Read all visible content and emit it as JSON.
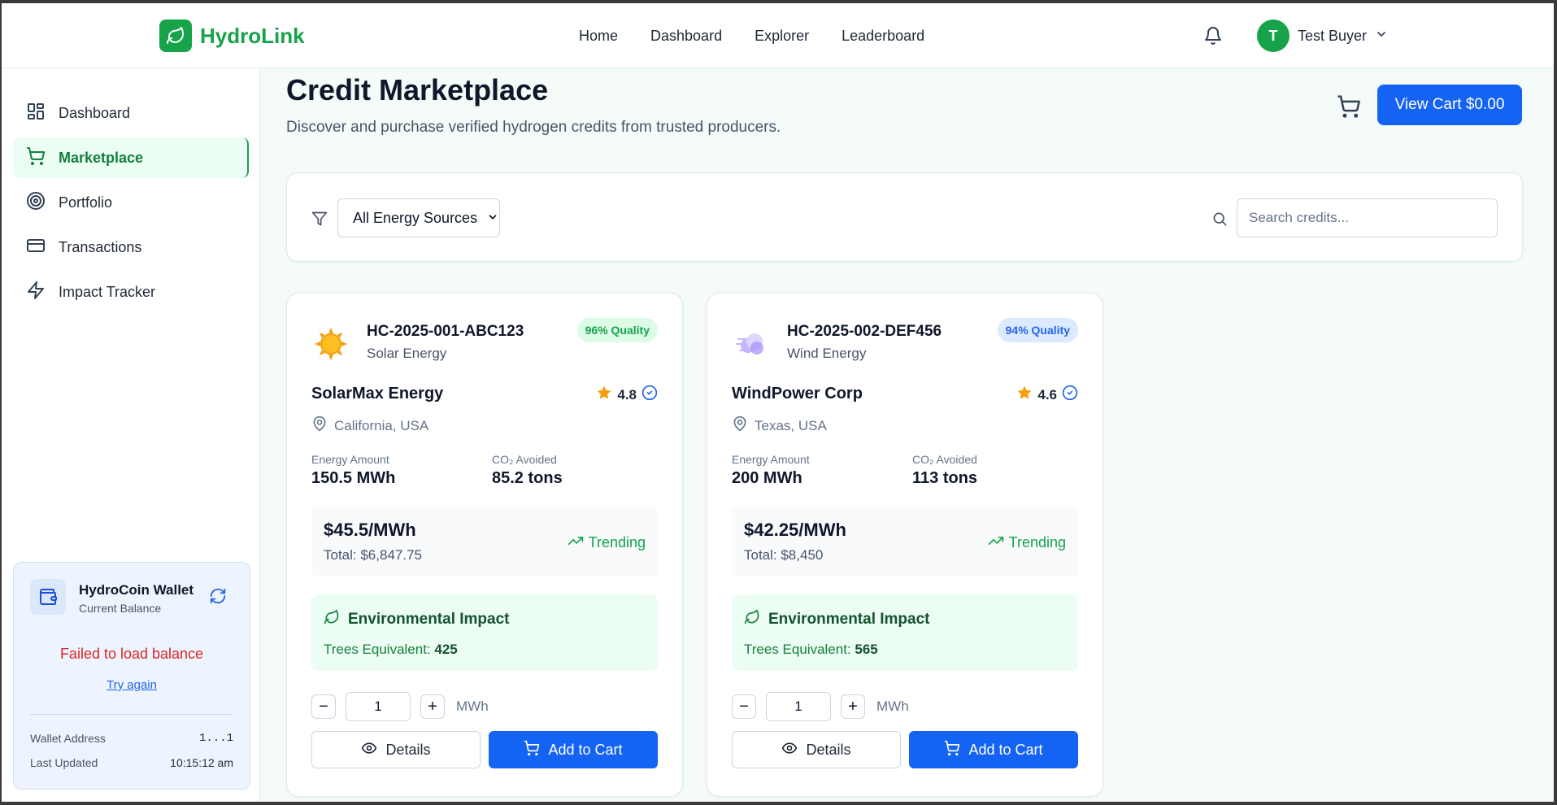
{
  "header": {
    "brand": "HydroLink",
    "nav": [
      "Home",
      "Dashboard",
      "Explorer",
      "Leaderboard"
    ],
    "user_initial": "T",
    "user_name": "Test Buyer"
  },
  "sidebar": {
    "items": [
      {
        "label": "Dashboard",
        "icon": "dashboard-grid-icon"
      },
      {
        "label": "Marketplace",
        "icon": "shopping-cart-icon"
      },
      {
        "label": "Portfolio",
        "icon": "target-icon"
      },
      {
        "label": "Transactions",
        "icon": "credit-card-icon"
      },
      {
        "label": "Impact Tracker",
        "icon": "lightning-icon"
      }
    ],
    "wallet": {
      "title": "HydroCoin Wallet",
      "subtitle": "Current Balance",
      "error": "Failed to load balance",
      "retry": "Try again",
      "address_label": "Wallet Address",
      "address_value": "1...1",
      "updated_label": "Last Updated",
      "updated_value": "10:15:12 am"
    }
  },
  "main": {
    "title": "Credit Marketplace",
    "subtitle": "Discover and purchase verified hydrogen credits from trusted producers.",
    "cart_button": "View Cart $0.00",
    "filter_value": "All Energy Sources",
    "search_placeholder": "Search credits..."
  },
  "cards": [
    {
      "id": "HC-2025-001-ABC123",
      "source": "Solar Energy",
      "quality": "96% Quality",
      "producer": "SolarMax Energy",
      "rating": "4.8",
      "location": "California, USA",
      "energy_label": "Energy Amount",
      "energy_value": "150.5 MWh",
      "co2_label": "CO₂ Avoided",
      "co2_value": "85.2 tons",
      "price": "$45.5/MWh",
      "total": "Total: $6,847.75",
      "trend": "Trending",
      "env_title": "Environmental Impact",
      "trees_label": "Trees Equivalent: ",
      "trees_value": "425",
      "qty": "1",
      "unit": "MWh",
      "details": "Details",
      "add": "Add to Cart"
    },
    {
      "id": "HC-2025-002-DEF456",
      "source": "Wind Energy",
      "quality": "94% Quality",
      "producer": "WindPower Corp",
      "rating": "4.6",
      "location": "Texas, USA",
      "energy_label": "Energy Amount",
      "energy_value": "200 MWh",
      "co2_label": "CO₂ Avoided",
      "co2_value": "113 tons",
      "price": "$42.25/MWh",
      "total": "Total: $8,450",
      "trend": "Trending",
      "env_title": "Environmental Impact",
      "trees_label": "Trees Equivalent: ",
      "trees_value": "565",
      "qty": "1",
      "unit": "MWh",
      "details": "Details",
      "add": "Add to Cart"
    }
  ],
  "colors": {
    "brand_green": "#16a34a",
    "primary_blue": "#1463f3",
    "error_red": "#dc2626"
  }
}
